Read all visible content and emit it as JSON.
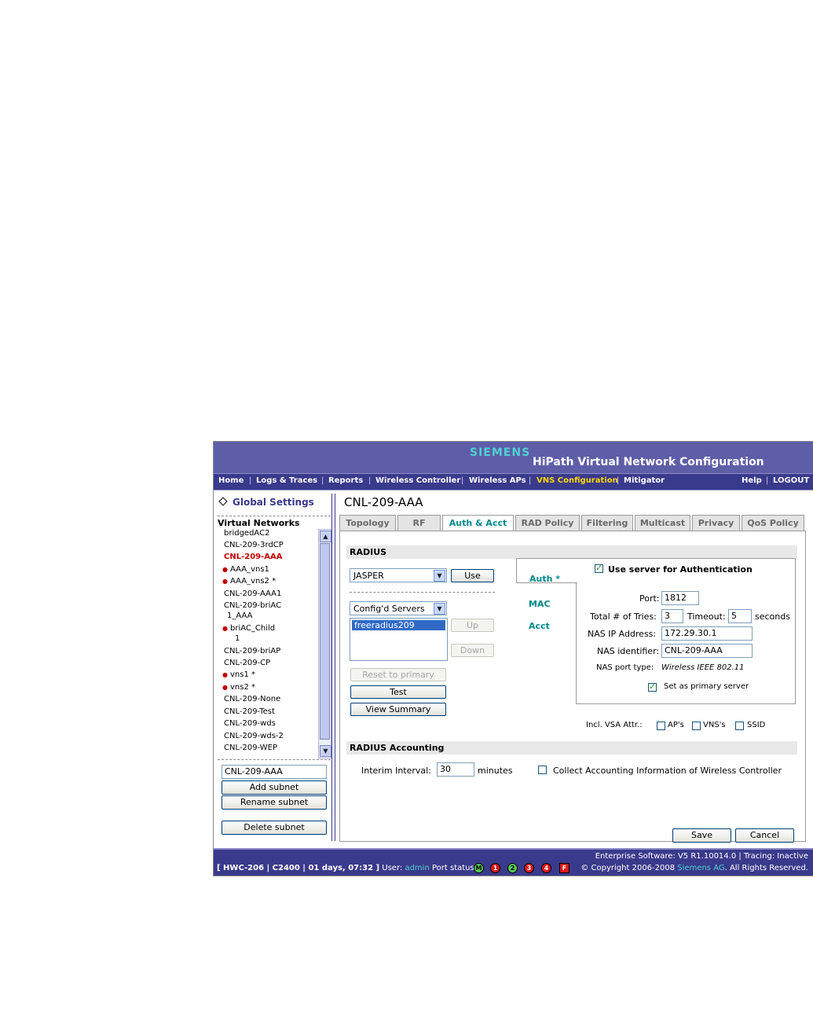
{
  "banner": {
    "brand": "SIEMENS",
    "title": "HiPath Virtual Network Configuration"
  },
  "nav": {
    "items": [
      "Home",
      "Logs & Traces",
      "Reports",
      "Wireless Controller",
      "Wireless APs",
      "VNS Configuration",
      "Mitigator",
      "Help",
      "LOGOUT"
    ],
    "active": "VNS Configuration",
    "separator": "|"
  },
  "sidebar": {
    "global_settings": "Global Settings",
    "virtual_networks_heading": "Virtual Networks",
    "networks": [
      "bridgedAC2",
      "CNL-209-3rdCP",
      "CNL-209-AAA",
      "AAA_vns1",
      "AAA_vns2 *",
      "CNL-209-AAA1",
      "CNL-209-briAC",
      "1_AAA",
      "briAC_Child",
      "1",
      "CNL-209-briAP",
      "CNL-209-CP",
      "vns1 *",
      "vns2 *",
      "CNL-209-None",
      "CNL-209-Test",
      "CNL-209-wds",
      "CNL-209-wds-2",
      "CNL-209-WEP"
    ],
    "selected_network": "CNL-209-AAA",
    "subnet_name_value": "CNL-209-AAA",
    "add_subnet": "Add subnet",
    "rename_subnet": "Rename subnet",
    "delete_subnet": "Delete subnet"
  },
  "page": {
    "title": "CNL-209-AAA",
    "tabs": [
      "Topology",
      "RF",
      "Auth & Acct",
      "RAD Policy",
      "Filtering",
      "Multicast",
      "Privacy",
      "QoS Policy"
    ],
    "active_tab": "Auth & Acct"
  },
  "radius": {
    "heading": "RADIUS",
    "server_select": "JASPER",
    "use_button": "Use",
    "servers_select": "Config'd Servers",
    "server_list": [
      "freeradius209"
    ],
    "up_button": "Up",
    "down_button": "Down",
    "reset_button": "Reset to primary",
    "test_button": "Test",
    "view_summary_button": "View Summary",
    "subtabs": {
      "auth": "Auth *",
      "mac": "MAC",
      "acct": "Acct"
    },
    "use_for_auth_label": "Use server for Authentication",
    "use_for_auth_checked": true,
    "port_label": "Port:",
    "port_value": "1812",
    "tries_label": "Total # of Tries:",
    "tries_value": "3",
    "timeout_label": "Timeout:",
    "timeout_value": "5",
    "seconds_label": "seconds",
    "nas_ip_label": "NAS IP Address:",
    "nas_ip_value": "172.29.30.1",
    "nas_id_label": "NAS identifier:",
    "nas_id_value": "CNL-209-AAA",
    "nas_port_type_label": "NAS port type:",
    "nas_port_type_value": "Wireless IEEE 802.11",
    "primary_label": "Set as primary server",
    "primary_checked": true,
    "vsa_label": "Incl. VSA Attr.:",
    "vsa_aps": "AP's",
    "vsa_vnss": "VNS's",
    "vsa_ssid": "SSID"
  },
  "accounting": {
    "heading": "RADIUS Accounting",
    "interim_label": "Interim Interval:",
    "interim_value": "30",
    "minutes_label": "minutes",
    "collect_label": "Collect Accounting Information of Wireless Controller",
    "collect_checked": false
  },
  "actions": {
    "save": "Save",
    "cancel": "Cancel"
  },
  "status": {
    "hwc": "[ HWC-206 | C2400 | 01 days, 07:32 ]",
    "user_label": "User:",
    "user": "admin",
    "port_status_label": "Port status:",
    "ports": [
      "M",
      "1",
      "2",
      "3",
      "4",
      "F"
    ],
    "software": "Enterprise Software: V5 R1.10014.0 | Tracing: Inactive",
    "copyright_pre": "© Copyright  2006-2008",
    "copyright_company": "Siemens AG",
    "copyright_post": ". All Rights Reserved."
  },
  "colors": {
    "banner": "#5e5ea8",
    "nav": "#3a3a8c",
    "accent": "#008888",
    "nav_active": "#ffd700",
    "selected": "#c00000"
  }
}
